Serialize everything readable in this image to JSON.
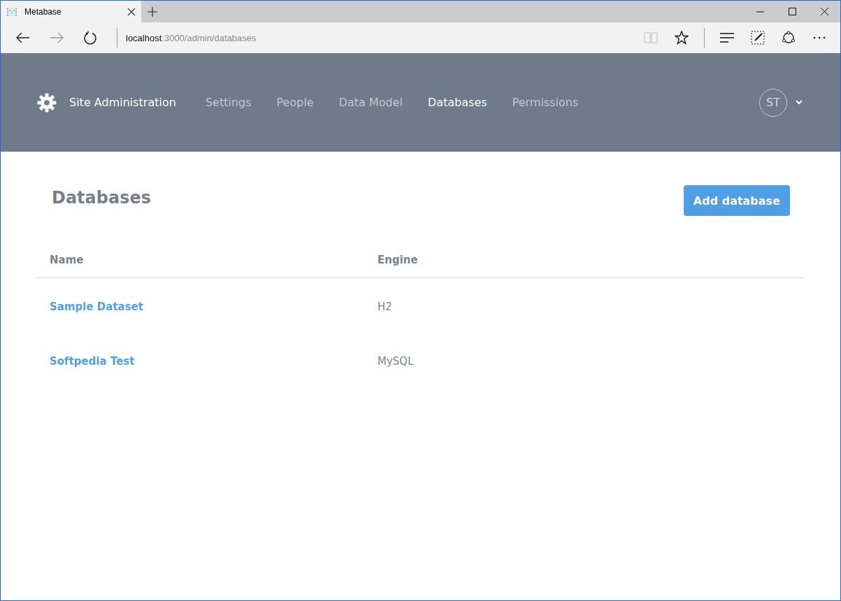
{
  "browser": {
    "tab": {
      "title": "Metabase"
    },
    "url": {
      "host": "localhost",
      "path": ":3000/admin/databases"
    }
  },
  "header": {
    "title": "Site Administration",
    "nav": [
      {
        "label": "Settings",
        "selected": false
      },
      {
        "label": "People",
        "selected": false
      },
      {
        "label": "Data Model",
        "selected": false
      },
      {
        "label": "Databases",
        "selected": true
      },
      {
        "label": "Permissions",
        "selected": false
      }
    ],
    "avatar": "ST"
  },
  "page": {
    "title": "Databases",
    "add_button": "Add database"
  },
  "table": {
    "columns": [
      "Name",
      "Engine"
    ],
    "rows": [
      [
        "Sample Dataset",
        "H2"
      ],
      [
        "Softpedia Test",
        "MySQL"
      ]
    ]
  }
}
